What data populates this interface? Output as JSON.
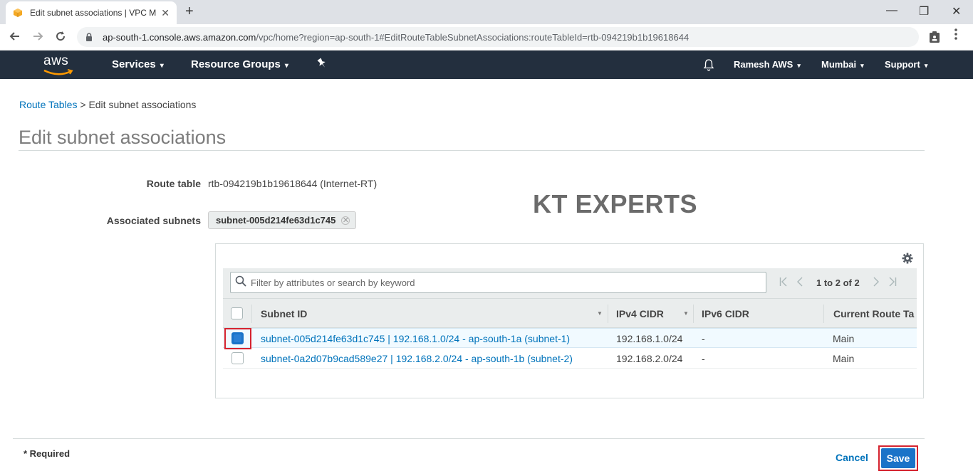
{
  "browser": {
    "tab_title": "Edit subnet associations | VPC M",
    "tab_close": "✕",
    "new_tab": "+",
    "url_host": "ap-south-1.console.aws.amazon.com",
    "url_path": "/vpc/home?region=ap-south-1#EditRouteTableSubnetAssociations:routeTableId=rtb-094219b1b19618644",
    "window_controls": [
      "—",
      "❐",
      "✕"
    ]
  },
  "aws_nav": {
    "logo_text": "aws",
    "services": "Services",
    "resource_groups": "Resource Groups",
    "user": "Ramesh AWS",
    "region": "Mumbai",
    "support": "Support",
    "caret": "▾"
  },
  "breadcrumb": {
    "parent": "Route Tables",
    "separator": ">",
    "current": "Edit subnet associations"
  },
  "page_title": "Edit subnet associations",
  "form": {
    "route_table_label": "Route table",
    "route_table_value": "rtb-094219b1b19618644 (Internet-RT)",
    "associated_subnets_label": "Associated subnets",
    "associated_subnet_token": "subnet-005d214fe63d1c745",
    "token_remove": "✕"
  },
  "watermark": "KT EXPERTS",
  "table": {
    "search_placeholder": "Filter by attributes or search by keyword",
    "pagination_text": "1 to 2 of 2",
    "pager_buttons": [
      "|<",
      "<",
      ">",
      ">|"
    ],
    "columns": [
      "Subnet ID",
      "IPv4 CIDR",
      "IPv6 CIDR",
      "Current Route Ta"
    ],
    "sort_caret": "▼",
    "rows": [
      {
        "selected": true,
        "subnet": "subnet-005d214fe63d1c745 | 192.168.1.0/24 - ap-south-1a (subnet-1)",
        "ipv4": "192.168.1.0/24",
        "ipv6": "-",
        "route_table": "Main"
      },
      {
        "selected": false,
        "subnet": "subnet-0a2d07b9cad589e27 | 192.168.2.0/24 - ap-south-1b (subnet-2)",
        "ipv4": "192.168.2.0/24",
        "ipv6": "-",
        "route_table": "Main"
      }
    ]
  },
  "footer": {
    "required_note": "* Required",
    "cancel_label": "Cancel",
    "save_label": "Save"
  },
  "colors": {
    "aws_nav_bg": "#232f3e",
    "link_blue": "#0073bb",
    "primary_button": "#1a73c8",
    "highlight_red": "#d5232f"
  }
}
